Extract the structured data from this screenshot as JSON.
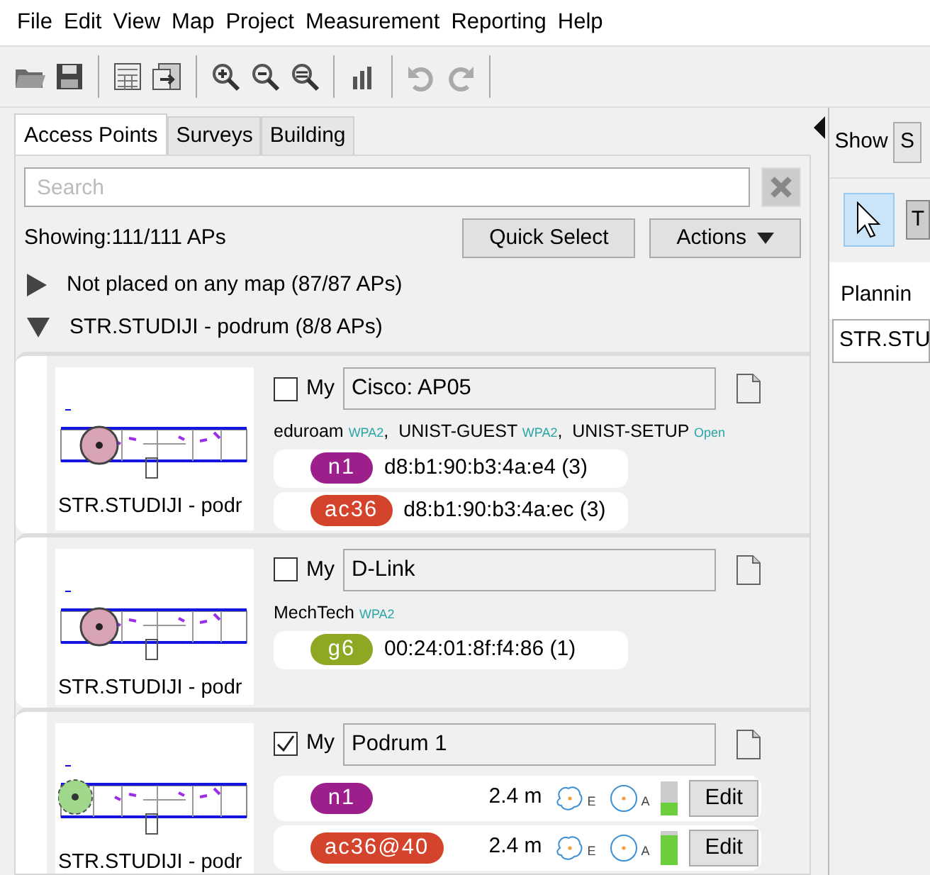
{
  "menu": [
    "File",
    "Edit",
    "View",
    "Map",
    "Project",
    "Measurement",
    "Reporting",
    "Help"
  ],
  "tabs": [
    {
      "label": "Access Points",
      "selected": true
    },
    {
      "label": "Surveys",
      "selected": false
    },
    {
      "label": "Building",
      "selected": false
    }
  ],
  "search": {
    "placeholder": "Search"
  },
  "summary": "Showing:111/111 APs",
  "buttons": {
    "quick_select": "Quick Select",
    "actions": "Actions"
  },
  "groups": [
    {
      "label": "Not placed on any map (87/87 APs)",
      "expanded": false
    },
    {
      "label": "STR.STUDIJI - podrum (8/8 APs)",
      "expanded": true
    }
  ],
  "access_points": [
    {
      "kind": "measured",
      "map_caption": "STR.STUDIJI - podr",
      "my_label": "My",
      "my": false,
      "name": "Cisco: AP05",
      "ssids": [
        {
          "name": "eduroam",
          "security": "WPA2",
          "separator": ","
        },
        {
          "name": "UNIST-GUEST",
          "security": "WPA2",
          "separator": ","
        },
        {
          "name": "UNIST-SETUP",
          "security": "Open"
        }
      ],
      "radios": [
        {
          "kind": "mac",
          "band": "n1",
          "color": "#9c1f8c",
          "mac": "d8:b1:90:b3:4a:e4 (3)"
        },
        {
          "kind": "mac",
          "band": "ac36",
          "color": "#d4432c",
          "mac": "d8:b1:90:b3:4a:ec (3)"
        }
      ]
    },
    {
      "kind": "measured",
      "map_caption": "STR.STUDIJI - podr",
      "my_label": "My",
      "my": false,
      "name": "D-Link",
      "ssids": [
        {
          "name": "MechTech",
          "security": "WPA2"
        }
      ],
      "radios": [
        {
          "kind": "mac",
          "band": "g6",
          "color": "#8ea823",
          "mac": "00:24:01:8f:f4:86 (1)"
        }
      ]
    },
    {
      "kind": "planned",
      "map_caption": "STR.STUDIJI - podr",
      "my_label": "My",
      "my": true,
      "name": "Podrum 1",
      "radios": [
        {
          "kind": "planned",
          "band": "n1",
          "color": "#9c1f8c",
          "distance": "2.4 m",
          "sub_e": "E",
          "sub_a": "A",
          "level": 0.35,
          "edit": "Edit"
        },
        {
          "kind": "planned",
          "band": "ac36@40",
          "color": "#d4432c",
          "distance": "2.4 m",
          "sub_e": "E",
          "sub_a": "A",
          "level": 0.85,
          "edit": "Edit"
        }
      ]
    }
  ],
  "right_panel": {
    "show_label": "Show",
    "show_value": "S",
    "tool_letter": "T",
    "section": "Plannin",
    "map_field": "STR.STU"
  }
}
